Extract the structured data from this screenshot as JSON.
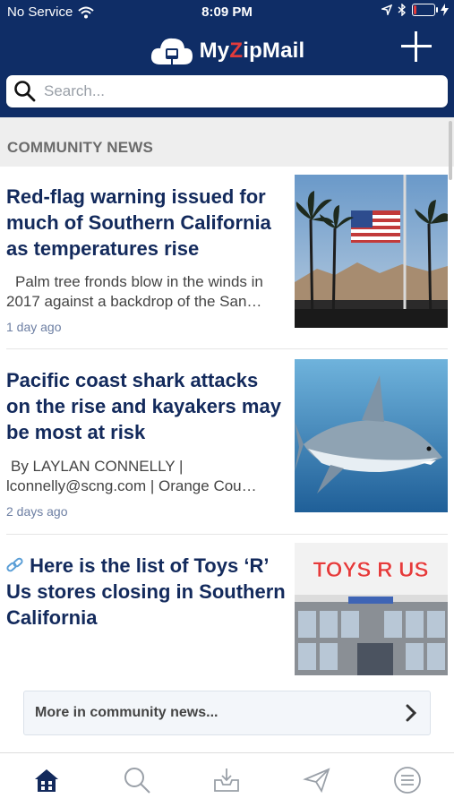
{
  "status": {
    "carrier": "No Service",
    "time": "8:09 PM"
  },
  "app": {
    "name_prefix": "My",
    "name_z": "Z",
    "name_suffix": "ipMail"
  },
  "search": {
    "placeholder": "Search..."
  },
  "section": {
    "title": "COMMUNITY NEWS"
  },
  "articles": [
    {
      "title": "Red-flag warning issued for much of Southern California as temperatures rise",
      "summary": "Palm tree fronds blow in the winds in 2017 against a backdrop of the San…",
      "time": "1 day ago",
      "image": "palm-trees-flag-photo"
    },
    {
      "title": "Pacific coast shark attacks on the rise and kayakers may be most at risk",
      "summary": "By LAYLAN CONNELLY | lconnelly@scng.com | Orange Cou…",
      "time": "2 days ago",
      "image": "shark-photo"
    },
    {
      "title": "Here is the list of Toys ‘R’ Us stores closing in Southern California",
      "link_icon": "link-icon",
      "image": "toys-r-us-storefront-photo",
      "image_sign": "TOYS R US"
    }
  ],
  "more": {
    "label": "More in community news..."
  },
  "tabs": [
    "home-icon",
    "search-icon",
    "inbox-icon",
    "send-icon",
    "menu-icon"
  ],
  "colors": {
    "header": "#0f2d66",
    "accent_red": "#e23b3b",
    "title": "#132a5c",
    "active_tab": "#132a5c",
    "inactive_tab": "#9aa0a8"
  }
}
